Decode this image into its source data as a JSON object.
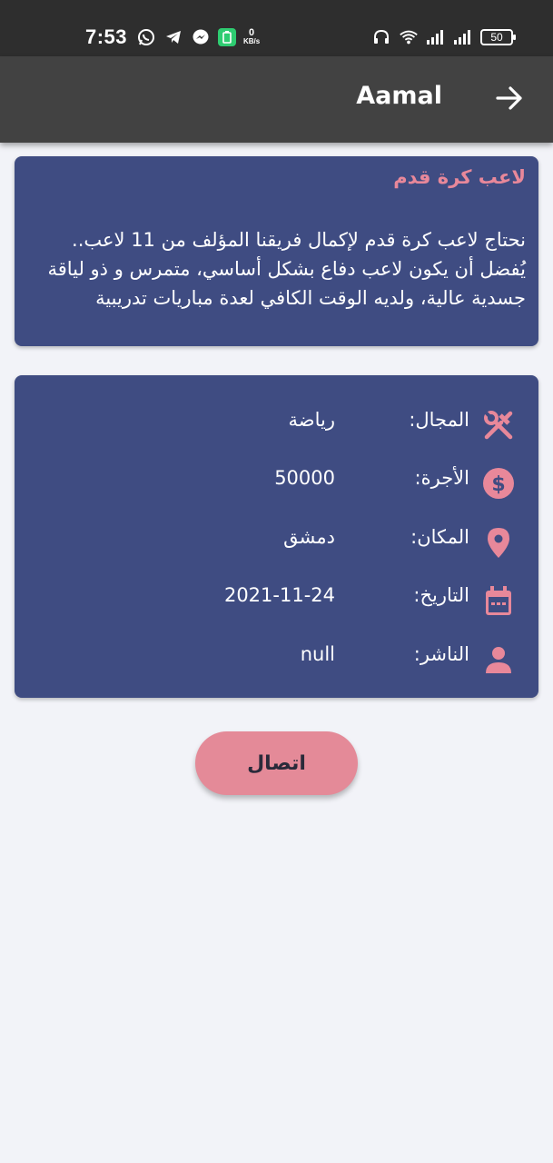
{
  "status_bar": {
    "time": "7:53",
    "net_speed_value": "0",
    "net_speed_unit": "KB/s",
    "battery": "50"
  },
  "app_bar": {
    "title": "Aamal",
    "back_icon": "arrow-right-icon"
  },
  "job": {
    "title": "لاعب كرة قدم",
    "description": "نحتاج لاعب كرة قدم لإكمال فريقنا المؤلف من 11 لاعب.. يُفضل أن يكون لاعب دفاع بشكل أساسي، متمرس و ذو لياقة جسدية عالية، ولديه الوقت الكافي لعدة مباريات تدريبية"
  },
  "details": [
    {
      "icon": "tools-icon",
      "label": "المجال:",
      "value": "رياضة"
    },
    {
      "icon": "dollar-icon",
      "label": "الأجرة:",
      "value": "50000"
    },
    {
      "icon": "location-pin-icon",
      "label": "المكان:",
      "value": "دمشق"
    },
    {
      "icon": "calendar-icon",
      "label": "التاريخ:",
      "value": "2021-11-24"
    },
    {
      "icon": "person-icon",
      "label": "الناشر:",
      "value": "null"
    }
  ],
  "contact_button": {
    "label": "اتصال"
  },
  "colors": {
    "card_bg": "#3f4c82",
    "accent_pink": "#e48a98",
    "app_bar": "#424242",
    "page_bg": "#f2f3f8"
  }
}
